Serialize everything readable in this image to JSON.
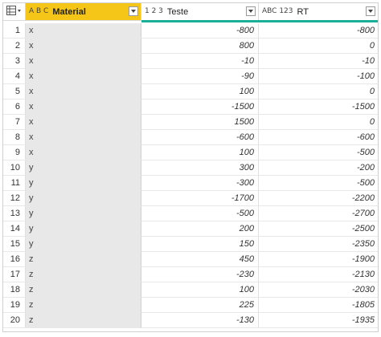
{
  "header": {
    "material": {
      "type_icon": "A B C",
      "label": "Material"
    },
    "teste": {
      "type_icon": "1 2 3",
      "label": "Teste"
    },
    "rt": {
      "type_icon": "ABC 123",
      "label": "RT"
    }
  },
  "accent_color": "#1aaf9a",
  "selected_column_color": "#f5c518",
  "rows": [
    {
      "idx": "1",
      "material": "x",
      "teste": "-800",
      "rt": "-800"
    },
    {
      "idx": "2",
      "material": "x",
      "teste": "800",
      "rt": "0"
    },
    {
      "idx": "3",
      "material": "x",
      "teste": "-10",
      "rt": "-10"
    },
    {
      "idx": "4",
      "material": "x",
      "teste": "-90",
      "rt": "-100"
    },
    {
      "idx": "5",
      "material": "x",
      "teste": "100",
      "rt": "0"
    },
    {
      "idx": "6",
      "material": "x",
      "teste": "-1500",
      "rt": "-1500"
    },
    {
      "idx": "7",
      "material": "x",
      "teste": "1500",
      "rt": "0"
    },
    {
      "idx": "8",
      "material": "x",
      "teste": "-600",
      "rt": "-600"
    },
    {
      "idx": "9",
      "material": "x",
      "teste": "100",
      "rt": "-500"
    },
    {
      "idx": "10",
      "material": "y",
      "teste": "300",
      "rt": "-200"
    },
    {
      "idx": "11",
      "material": "y",
      "teste": "-300",
      "rt": "-500"
    },
    {
      "idx": "12",
      "material": "y",
      "teste": "-1700",
      "rt": "-2200"
    },
    {
      "idx": "13",
      "material": "y",
      "teste": "-500",
      "rt": "-2700"
    },
    {
      "idx": "14",
      "material": "y",
      "teste": "200",
      "rt": "-2500"
    },
    {
      "idx": "15",
      "material": "y",
      "teste": "150",
      "rt": "-2350"
    },
    {
      "idx": "16",
      "material": "z",
      "teste": "450",
      "rt": "-1900"
    },
    {
      "idx": "17",
      "material": "z",
      "teste": "-230",
      "rt": "-2130"
    },
    {
      "idx": "18",
      "material": "z",
      "teste": "100",
      "rt": "-2030"
    },
    {
      "idx": "19",
      "material": "z",
      "teste": "225",
      "rt": "-1805"
    },
    {
      "idx": "20",
      "material": "z",
      "teste": "-130",
      "rt": "-1935"
    }
  ]
}
